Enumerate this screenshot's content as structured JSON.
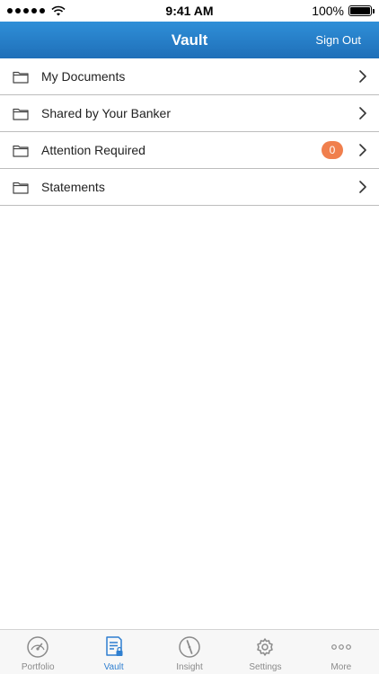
{
  "status_bar": {
    "time": "9:41 AM",
    "battery": "100%",
    "signal_icon": "signal-dots-icon",
    "wifi_icon": "wifi-icon",
    "battery_icon": "battery-icon"
  },
  "header": {
    "title": "Vault",
    "action": "Sign Out",
    "colors": {
      "gradient_top": "#2f8fd8",
      "gradient_bottom": "#1f6fb8"
    }
  },
  "list": {
    "items": [
      {
        "label": "My Documents",
        "icon": "folder-icon"
      },
      {
        "label": "Shared by Your Banker",
        "icon": "folder-icon"
      },
      {
        "label": "Attention Required",
        "icon": "folder-icon",
        "badge": "0"
      },
      {
        "label": "Statements",
        "icon": "folder-icon"
      }
    ],
    "badge_color": "#f07f4d"
  },
  "tab_bar": {
    "tabs": [
      {
        "label": "Portfolio",
        "icon": "gauge-icon"
      },
      {
        "label": "Vault",
        "icon": "document-lock-icon",
        "active": true
      },
      {
        "label": "Insight",
        "icon": "compass-icon"
      },
      {
        "label": "Settings",
        "icon": "gear-icon"
      },
      {
        "label": "More",
        "icon": "more-dots-icon"
      }
    ],
    "active_color": "#2f7fd0"
  }
}
